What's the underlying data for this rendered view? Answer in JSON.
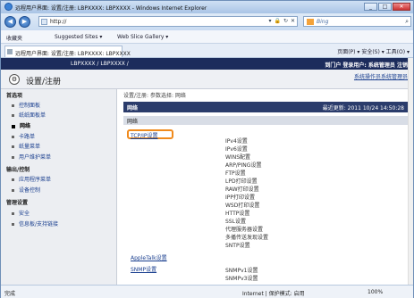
{
  "window": {
    "title": "远程用户界面: 设置/注册: LBPXXXX: LBPXXXX - Windows Internet Explorer",
    "controls": [
      "_",
      "□",
      "✕"
    ]
  },
  "address_bar": {
    "url": "http://",
    "buttons": [
      "▾",
      "🔒",
      "↻",
      "✕"
    ],
    "search_placeholder": "Bing"
  },
  "favorites_bar": {
    "favorites_label": "收藏夹",
    "suggested_sites": "Suggested Sites ▾",
    "web_slice": "Web Slice Gallery ▾"
  },
  "tab": {
    "title": "远程用户界面: 设置/注册: LBPXXXX: LBPXXXX",
    "toolbar": "页面(P) ▾  安全(S) ▾  工具(O) ▾"
  },
  "header": {
    "product": "LBPXXXX / LBPXXXX /",
    "links": "到门户  登录用户: 系统管理员  注销"
  },
  "subheader": {
    "title": "设置/注册",
    "admin_link": "系统操作员系统管理员"
  },
  "sidebar": {
    "sections": [
      {
        "label": "首选项",
        "items": [
          "控制面板",
          "纸纸面板单",
          "网络",
          "卡路单",
          "纸量菜单",
          "用户维护菜单"
        ]
      },
      {
        "label": "输出/控制",
        "items": [
          "应用程序菜单",
          "设备控制"
        ]
      },
      {
        "label": "管理设置",
        "items": [
          "安全",
          "信息板/支持链接"
        ]
      }
    ],
    "active_item": "网络"
  },
  "main": {
    "breadcrumb": "设置/注册: 参数选择: 网络",
    "section_title": "网络",
    "last_updated": "最近更新: 2011 10/24 14:50:28",
    "group_title": "网络",
    "tcpip_link": "TCP/IP设置",
    "tcpip_items": [
      "IPv4设置",
      "IPv6设置",
      "WINS配置",
      "ARP/PING设置",
      "FTP设置",
      "LPD打印设置",
      "RAW打印设置",
      "IPP打印设置",
      "WSD打印设置",
      "HTTP设置",
      "SSL设置",
      "代理服务器设置",
      "多播传送发现设置",
      "SNTP设置"
    ],
    "appletalk_link": "AppleTalk设置",
    "snmp_link": "SNMP设置",
    "snmp_items": [
      "SNMPv1设置",
      "SNMPv3设置"
    ]
  },
  "status_bar": {
    "status": "完成",
    "zone": "Internet | 保护模式: 启用",
    "zoom": "100%"
  },
  "colors": {
    "header_bg": "#1c2c5c",
    "bluebar_bg": "#2b3c6b",
    "highlight": "#f08a1c"
  }
}
